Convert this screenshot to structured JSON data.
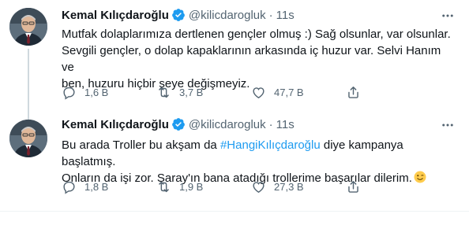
{
  "colors": {
    "accent": "#1d9bf0",
    "text": "#0f1419",
    "muted": "#536471",
    "thread_line": "#cfd9de"
  },
  "tweets": [
    {
      "name": "Kemal Kılıçdaroğlu",
      "handle": "@kilicdarogluk",
      "time": "11s",
      "lines": [
        "Mutfak dolaplarımıza dertlenen gençler olmuş :) Sağ olsunlar, var olsunlar.",
        "Sevgili gençler, o dolap kapaklarının arkasında iç huzur var. Selvi Hanım ve",
        "ben, huzuru hiçbir şeye değişmeyiz."
      ],
      "replies": "1,6 B",
      "retweets": "3,7 B",
      "likes": "47,7 B"
    },
    {
      "name": "Kemal Kılıçdaroğlu",
      "handle": "@kilicdarogluk",
      "time": "11s",
      "line1_before": "Bu arada Troller bu akşam da ",
      "hashtag": "#HangiKılıçdaroğlu",
      "line1_after": " diye kampanya başlatmış.",
      "line2": "Onların da işi zor. Saray'ın bana atadığı trollerime başarılar dilerim.",
      "replies": "1,8 B",
      "retweets": "1,9 B",
      "likes": "27,3 B"
    }
  ],
  "icons": {
    "verified": "verified-badge-icon",
    "more": "more-icon",
    "reply": "reply-icon",
    "retweet": "retweet-icon",
    "like": "like-icon",
    "share": "share-icon",
    "emoji": "winking-face-emoji"
  }
}
